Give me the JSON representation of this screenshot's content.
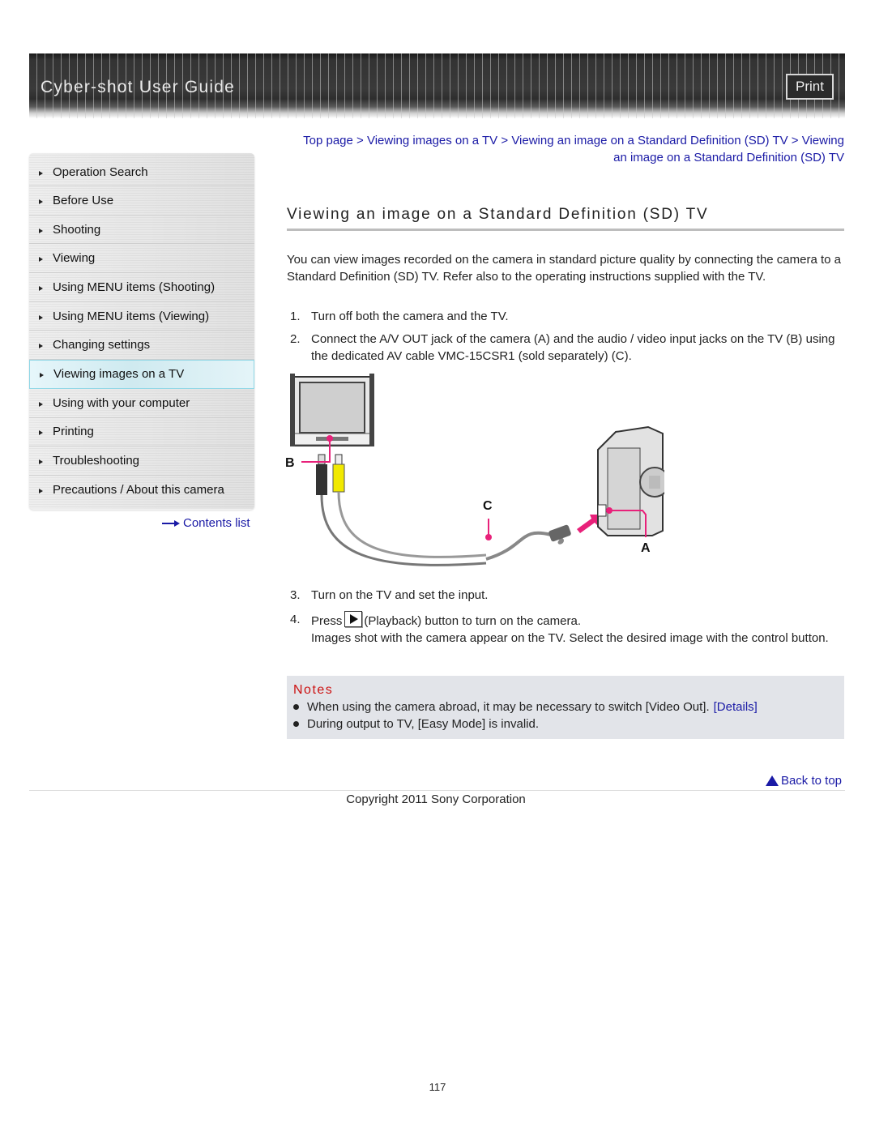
{
  "header": {
    "title": "Cyber-shot User Guide",
    "print_label": "Print"
  },
  "sidebar": {
    "items": [
      {
        "label": "Operation Search",
        "active": false
      },
      {
        "label": "Before Use",
        "active": false
      },
      {
        "label": "Shooting",
        "active": false
      },
      {
        "label": "Viewing",
        "active": false
      },
      {
        "label": "Using MENU items (Shooting)",
        "active": false
      },
      {
        "label": "Using MENU items (Viewing)",
        "active": false
      },
      {
        "label": "Changing settings",
        "active": false
      },
      {
        "label": "Viewing images on a TV",
        "active": true
      },
      {
        "label": "Using with your computer",
        "active": false
      },
      {
        "label": "Printing",
        "active": false
      },
      {
        "label": "Troubleshooting",
        "active": false
      },
      {
        "label": "Precautions / About this camera",
        "active": false
      }
    ],
    "contents_link": "Contents list"
  },
  "breadcrumb": {
    "items": [
      "Top page",
      "Viewing images on a TV",
      "Viewing an image on a Standard Definition (SD) TV",
      "Viewing an image on a Standard Definition (SD) TV"
    ],
    "separator": ">"
  },
  "main": {
    "title": "Viewing an image on a Standard Definition (SD) TV",
    "intro": "You can view images recorded on the camera in standard picture quality by connecting the camera to a Standard Definition (SD) TV. Refer also to the operating instructions supplied with the TV.",
    "steps": [
      {
        "num": "1.",
        "text": "Turn off both the camera and the TV."
      },
      {
        "num": "2.",
        "text": "Connect the A/V OUT jack of the camera (A) and the audio / video input jacks on the TV (B) using the dedicated AV cable VMC-15CSR1 (sold separately) (C)."
      },
      {
        "num": "3.",
        "text": "Turn on the TV and set the input."
      },
      {
        "num": "4.",
        "text_before": "Press",
        "icon": "playback-icon",
        "text_after": "(Playback) button to turn on the camera.",
        "detail": "Images shot with the camera appear on the TV. Select the desired image with the control button."
      }
    ],
    "diagram": {
      "labels": {
        "a": "A",
        "b": "B",
        "c": "C"
      },
      "accent_color": "#e8217a"
    }
  },
  "notes": {
    "title": "Notes",
    "items": [
      {
        "text": "When using the camera abroad, it may be necessary to switch [Video Out].",
        "link": "[Details]"
      },
      {
        "text": "During output to TV, [Easy Mode] is invalid."
      }
    ]
  },
  "footer": {
    "back_to_top": "Back to top",
    "copyright": "Copyright 2011 Sony Corporation",
    "page_number": "117"
  },
  "colors": {
    "link": "#1a1aa6",
    "notes_title": "#cc1111",
    "notes_bg": "#e2e4e9",
    "active_nav_border": "#8fd7e6"
  }
}
